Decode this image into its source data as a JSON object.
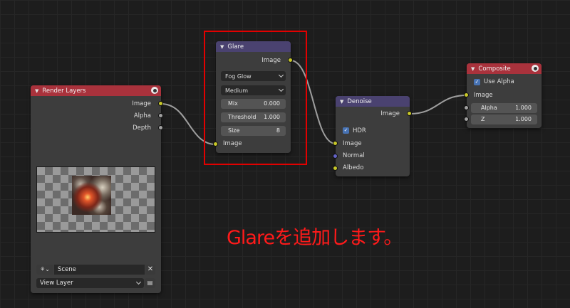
{
  "colors": {
    "background": "#1d1d1d",
    "node_body": "#3d3d3d",
    "header_output": "#a9323c",
    "header_filter": "#4a4270",
    "socket_color": "#c7c729",
    "socket_value": "#a1a1a1",
    "socket_vector": "#6363c7",
    "link": "#9e9e9e",
    "annotation": "#ff1a1a",
    "highlight_box": "#e20000"
  },
  "render_layers": {
    "title": "Render Layers",
    "outputs": [
      "Image",
      "Alpha",
      "Depth"
    ],
    "scene_icon": "scene-icon",
    "scene_value": "Scene",
    "view_layer_value": "View Layer"
  },
  "glare": {
    "title": "Glare",
    "output": "Image",
    "glare_type": "Fog Glow",
    "quality": "Medium",
    "mix_label": "Mix",
    "mix_value": "0.000",
    "threshold_label": "Threshold",
    "threshold_value": "1.000",
    "size_label": "Size",
    "size_value": "8",
    "input": "Image"
  },
  "denoise": {
    "title": "Denoise",
    "output": "Image",
    "hdr_label": "HDR",
    "hdr_checked": true,
    "inputs": [
      "Image",
      "Normal",
      "Albedo"
    ]
  },
  "composite": {
    "title": "Composite",
    "use_alpha_label": "Use Alpha",
    "use_alpha_checked": true,
    "input_image": "Image",
    "alpha_label": "Alpha",
    "alpha_value": "1.000",
    "z_label": "Z",
    "z_value": "1.000"
  },
  "annotation_text": "Glareを追加します。"
}
